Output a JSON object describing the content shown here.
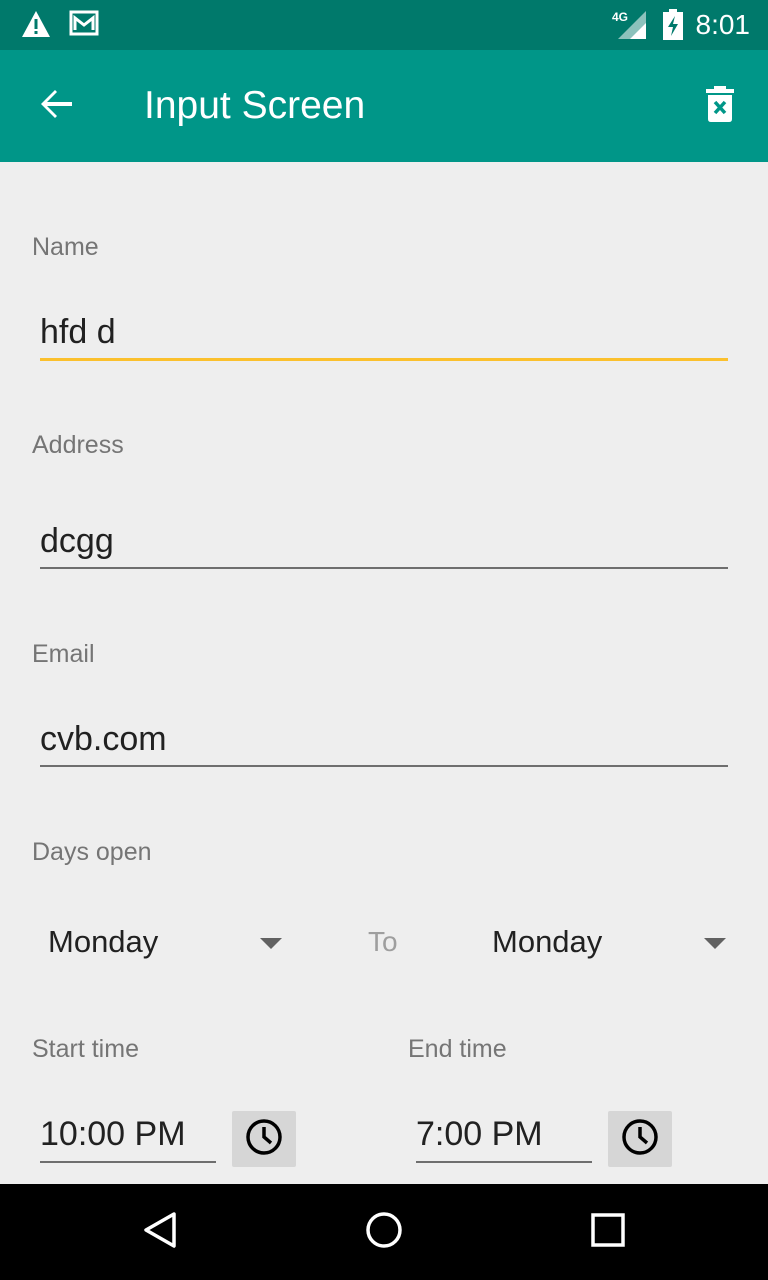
{
  "status_bar": {
    "time": "8:01",
    "network": "4G",
    "icons": [
      "warning-icon",
      "gmail-icon",
      "signal-icon",
      "battery-charging-icon"
    ]
  },
  "app_bar": {
    "title": "Input Screen",
    "back_icon": "arrow-back-icon",
    "delete_icon": "delete-icon"
  },
  "form": {
    "name": {
      "label": "Name",
      "value": "hfd d"
    },
    "address": {
      "label": "Address",
      "value": "dcgg"
    },
    "email": {
      "label": "Email",
      "value": "cvb.com"
    },
    "days_open": {
      "label": "Days open",
      "from": "Monday",
      "to_label": "To",
      "to": "Monday"
    },
    "start_time": {
      "label": "Start time",
      "value": "10:00 PM"
    },
    "end_time": {
      "label": "End time",
      "value": "7:00 PM"
    }
  },
  "colors": {
    "status_bar": "#00796b",
    "app_bar": "#009688",
    "focus_accent": "#fbc02d",
    "background": "#eeeeee"
  },
  "nav_bar": {
    "icons": [
      "back-triangle-icon",
      "home-circle-icon",
      "recents-square-icon"
    ]
  }
}
